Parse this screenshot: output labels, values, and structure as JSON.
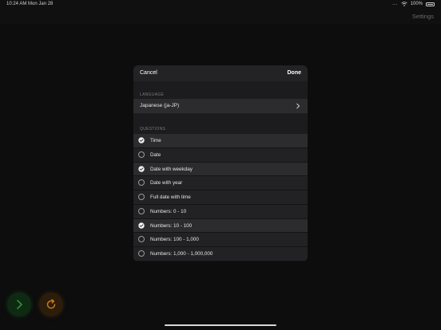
{
  "status_bar": {
    "time": "10:24 AM  Mon Jan 28",
    "dots": "...",
    "battery": "100%"
  },
  "header": {
    "settings_label": "Settings"
  },
  "modal": {
    "cancel_label": "Cancel",
    "done_label": "Done",
    "language_section_title": "LANGUAGE",
    "language_value": "Japanese (ja-JP)",
    "questions_section_title": "QUESTIONS",
    "questions": [
      {
        "label": "Time",
        "checked": true
      },
      {
        "label": "Date",
        "checked": false
      },
      {
        "label": "Date with weekday",
        "checked": true
      },
      {
        "label": "Date with year",
        "checked": false
      },
      {
        "label": "Full date with time",
        "checked": false
      },
      {
        "label": "Numbers: 0 - 10",
        "checked": false
      },
      {
        "label": "Numbers: 10 - 100",
        "checked": true
      },
      {
        "label": "Numbers: 100 - 1,000",
        "checked": false
      },
      {
        "label": "Numbers: 1,000 - 1,000,000",
        "checked": false
      }
    ]
  },
  "colors": {
    "next_accent": "#2f8f3a",
    "refresh_accent": "#c8791e"
  },
  "icons": {
    "next": "chevron-right-icon",
    "refresh": "refresh-icon"
  }
}
